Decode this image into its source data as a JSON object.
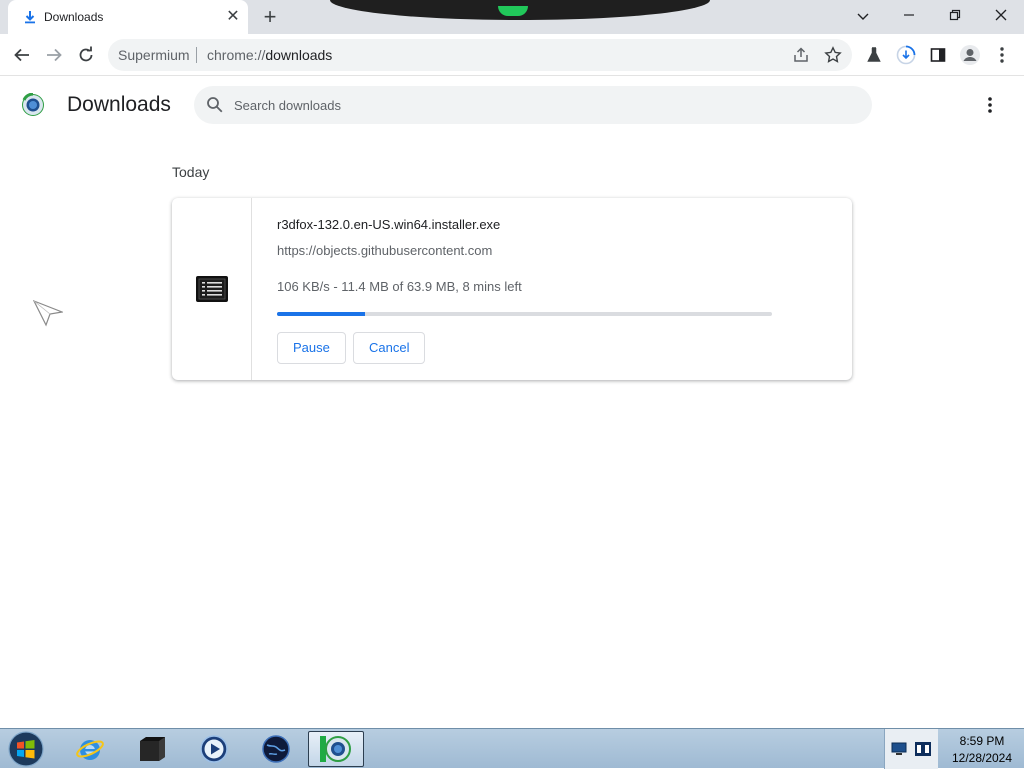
{
  "tab": {
    "title": "Downloads"
  },
  "omnibox": {
    "brand": "Supermium",
    "url_prefix": "chrome://",
    "url_page": "downloads"
  },
  "page": {
    "title": "Downloads",
    "search_placeholder": "Search downloads"
  },
  "downloads": {
    "section_label": "Today",
    "items": [
      {
        "file_name": "r3dfox-132.0.en-US.win64.installer.exe",
        "source_url": "https://objects.githubusercontent.com",
        "status": "106 KB/s - 11.4 MB of 63.9 MB, 8 mins left",
        "progress_percent": 17.8,
        "pause_label": "Pause",
        "cancel_label": "Cancel"
      }
    ]
  },
  "taskbar": {
    "apps": [
      "internet-explorer",
      "terminal",
      "media-player",
      "globe-browser",
      "supermium"
    ],
    "clock_time": "8:59 PM",
    "clock_date": "12/28/2024"
  },
  "colors": {
    "accent": "#1a73e8",
    "tab_strip": "#dee1e6"
  }
}
